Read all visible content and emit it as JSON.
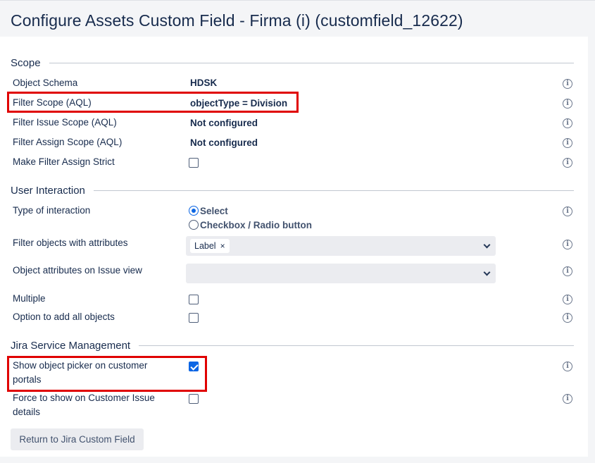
{
  "header": {
    "title": "Configure Assets Custom Field - Firma (i) (customfield_12622)"
  },
  "scope": {
    "title": "Scope",
    "object_schema": {
      "label": "Object Schema",
      "value": "HDSK"
    },
    "filter_scope": {
      "label": "Filter Scope (AQL)",
      "value": "objectType = Division"
    },
    "filter_issue_scope": {
      "label": "Filter Issue Scope (AQL)",
      "value": "Not configured"
    },
    "filter_assign_scope": {
      "label": "Filter Assign Scope (AQL)",
      "value": "Not configured"
    },
    "make_filter_assign_strict": {
      "label": "Make Filter Assign Strict",
      "checked": false
    }
  },
  "user_interaction": {
    "title": "User Interaction",
    "type_of_interaction": {
      "label": "Type of interaction",
      "options": [
        "Select",
        "Checkbox / Radio button"
      ],
      "selected": "Select"
    },
    "filter_objects_with_attributes": {
      "label": "Filter objects with attributes",
      "tags": [
        "Label"
      ]
    },
    "object_attributes_on_issue_view": {
      "label": "Object attributes on Issue view"
    },
    "multiple": {
      "label": "Multiple",
      "checked": false
    },
    "option_add_all": {
      "label": "Option to add all objects",
      "checked": false
    }
  },
  "jsm": {
    "title": "Jira Service Management",
    "show_object_picker": {
      "label": "Show object picker on customer portals",
      "checked": true
    },
    "force_show": {
      "label": "Force to show on Customer Issue details",
      "checked": false
    }
  },
  "footer": {
    "return_button": "Return to Jira Custom Field"
  },
  "icons": {
    "info": "info-circle-icon",
    "remove": "close-icon",
    "dropdown": "chevron-down-icon",
    "info_glyph": "i",
    "remove_glyph": "×"
  },
  "colors": {
    "highlight": "#e00000",
    "checkbox_checked": "#0c66e4",
    "field_bg": "#ebecf0"
  }
}
